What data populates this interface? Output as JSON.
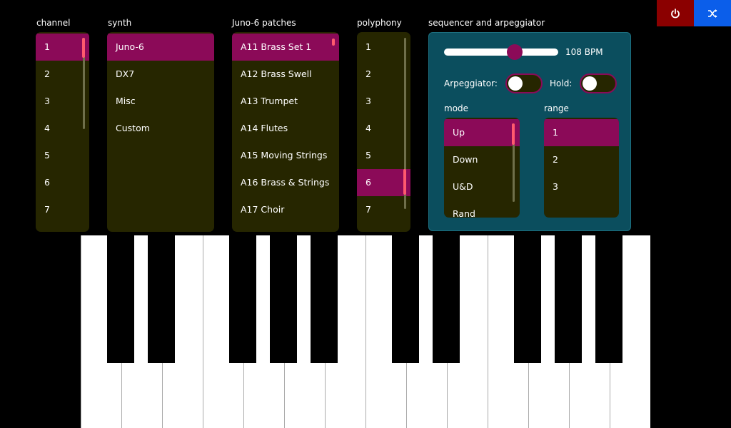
{
  "top_buttons": {
    "power_color": "#8b0000",
    "shuffle_color": "#0b5eea",
    "power_icon": "power-icon",
    "shuffle_icon": "shuffle-icon"
  },
  "channel": {
    "label": "channel",
    "items": [
      "1",
      "2",
      "3",
      "4",
      "5",
      "6",
      "7"
    ],
    "selected": "1"
  },
  "synth": {
    "label": "synth",
    "items": [
      "Juno-6",
      "DX7",
      "Misc",
      "Custom"
    ],
    "selected": "Juno-6"
  },
  "patches": {
    "label": "Juno-6 patches",
    "items": [
      "A11 Brass Set 1",
      "A12 Brass Swell",
      "A13 Trumpet",
      "A14 Flutes",
      "A15 Moving Strings",
      "A16 Brass & Strings",
      "A17 Choir"
    ],
    "selected": "A11 Brass Set 1"
  },
  "polyphony": {
    "label": "polyphony",
    "items": [
      "1",
      "2",
      "3",
      "4",
      "5",
      "6",
      "7"
    ],
    "selected": "6"
  },
  "sequencer": {
    "label": "sequencer and arpeggiator",
    "bpm_label": "108 BPM",
    "tempo_fraction": 0.62,
    "arpeggiator_label": "Arpeggiator:",
    "arpeggiator_on": false,
    "hold_label": "Hold:",
    "hold_on": false,
    "mode_label": "mode",
    "mode_items": [
      "Up",
      "Down",
      "U&D",
      "Rand"
    ],
    "mode_selected": "Up",
    "range_label": "range",
    "range_items": [
      "1",
      "2",
      "3"
    ],
    "range_selected": "1"
  },
  "colors": {
    "accent": "#8b0a58",
    "list_bg": "#262600",
    "panel_bg": "#0b4e5e",
    "scroll_thumb": "#ff5a6e"
  }
}
